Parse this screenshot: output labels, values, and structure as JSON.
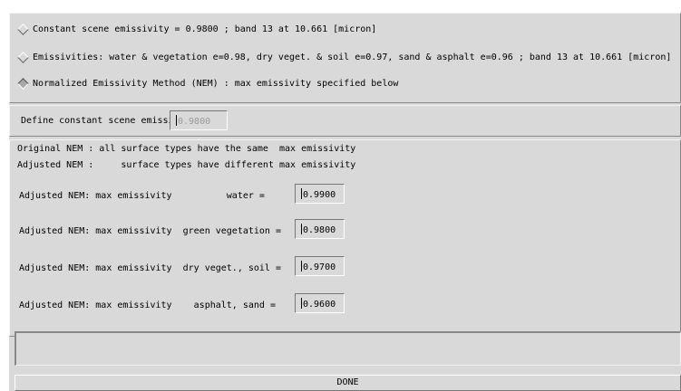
{
  "radio_options": [
    {
      "label": "Constant scene emissivity = 0.9800 ; band 13  at 10.661 [micron]",
      "selected": false
    },
    {
      "label": "Emissivities: water & vegetation e=0.98, dry veget. & soil e=0.97, sand & asphalt e=0.96 ; band 13  at 10.661 [micron]",
      "selected": false
    },
    {
      "label": "Normalized Emissivity Method (NEM) : max emissivity specified below",
      "selected": true
    }
  ],
  "constant_emissivity": {
    "label": "Define constant scene emissivity = ",
    "value": "0.9800"
  },
  "nem": {
    "original_line": "Original NEM : all surface types have the same  max emissivity",
    "adjusted_line": "Adjusted NEM :     surface types have different max emissivity",
    "rows": [
      {
        "label": "Adjusted NEM: max emissivity          water = ",
        "value": "0.9900"
      },
      {
        "label": "Adjusted NEM: max emissivity  green vegetation = ",
        "value": "0.9800"
      },
      {
        "label": "Adjusted NEM: max emissivity  dry veget., soil = ",
        "value": "0.9700"
      },
      {
        "label": "Adjusted NEM: max emissivity    asphalt, sand = ",
        "value": "0.9600"
      }
    ]
  },
  "status_text": "",
  "done_button": {
    "label": "DONE"
  },
  "colors": {
    "background": "#d9d9d9",
    "disabled_text": "#9a9a9a"
  }
}
